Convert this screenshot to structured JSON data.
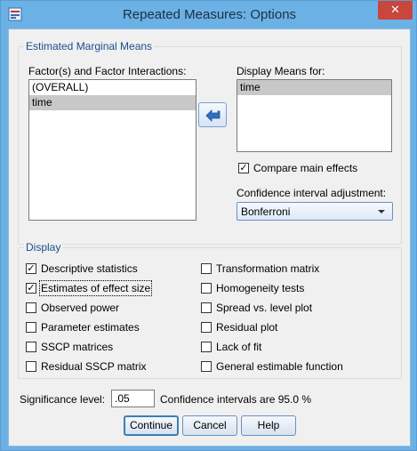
{
  "window": {
    "title": "Repeated Measures: Options",
    "close_glyph": "✕"
  },
  "emm": {
    "group_title": "Estimated Marginal Means",
    "factors_label": "Factor(s) and Factor Interactions:",
    "factors": [
      "(OVERALL)",
      "time"
    ],
    "display_means_label": "Display Means for:",
    "display_means": [
      "time"
    ],
    "compare_main_effects": {
      "label": "Compare main effects",
      "checked": true
    },
    "ci_adjustment_label": "Confidence interval adjustment:",
    "ci_adjustment_value": "Bonferroni"
  },
  "display": {
    "group_title": "Display",
    "left": [
      {
        "label": "Descriptive statistics",
        "checked": true
      },
      {
        "label": "Estimates of effect size",
        "checked": true
      },
      {
        "label": "Observed power",
        "checked": false
      },
      {
        "label": "Parameter estimates",
        "checked": false
      },
      {
        "label": "SSCP matrices",
        "checked": false
      },
      {
        "label": "Residual SSCP matrix",
        "checked": false
      }
    ],
    "right": [
      {
        "label": "Transformation matrix",
        "checked": false
      },
      {
        "label": "Homogeneity tests",
        "checked": false
      },
      {
        "label": "Spread vs. level plot",
        "checked": false
      },
      {
        "label": "Residual plot",
        "checked": false
      },
      {
        "label": "Lack of fit",
        "checked": false
      },
      {
        "label": "General estimable function",
        "checked": false
      }
    ]
  },
  "significance": {
    "label": "Significance level:",
    "value": ".05",
    "ci_text": "Confidence intervals are 95.0 %"
  },
  "buttons": {
    "continue": "Continue",
    "cancel": "Cancel",
    "help": "Help"
  },
  "icons": {
    "app": "spss-dialog-icon",
    "move_arrow": "move-left-arrow-icon",
    "close": "close-icon"
  }
}
